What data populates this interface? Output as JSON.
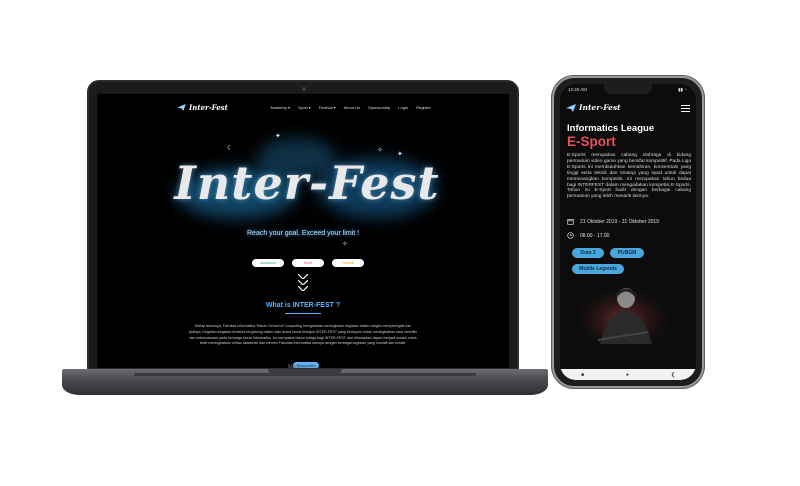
{
  "laptop": {
    "device_label": "MacBook Pro",
    "site": {
      "logo_text": "Inter-Fest",
      "nav": [
        "Academy ▾",
        "Sport ▾",
        "Festival ▾",
        "About Us",
        "Sponsorship",
        "Login",
        "Register"
      ],
      "hero_title": "Inter-Fest",
      "hero_tagline": "Reach your goal, Exceed your limit !",
      "pills": [
        {
          "label": "Academic",
          "color": "#2a9d8f"
        },
        {
          "label": "Sport",
          "color": "#e05a5a"
        },
        {
          "label": "Festival",
          "color": "#d9a21b"
        }
      ],
      "what_title": "What is INTER-FEST ?",
      "description": "Setiap tahunnya, Fakultas Informatika Telkom School of Computing mengadakan serangkaian kegiatan dalam rangka memperingati hari jadinya. Kegiatan-kegiatan tersebut tergabung dalam satu acara besar bertajuk INTER-FEST yang bertujuan untuk meningkatkan rasa memiliki dan kebersamaan pada keluarga besar Informatika. Ini merupakan tahun ketiga bagi INTER-FEST dan diharapkan dapat menjadi wadah untuk lebih meningkatkan civitas akademik dan elemen Fakultas Informatika lainnya dengan berbagai kegiatan yang inovatif dan kreatif.",
      "read_more": "Read more"
    }
  },
  "phone": {
    "status_time": "12:40 AM",
    "status_icons": "▮▮ ◔",
    "logo_text": "Inter-Fest",
    "league": "Informatics League",
    "title": "E-Sport",
    "description": "E-Sports merupakan cabang olahraga di bidang permainan video game yang bersifat kompetitif. Pada Liga E-Sports ini membutuhkan kemahiran, konsentrasi yang tinggi serta teknik dan strategi yang tepat untuk dapat memenangkan kompetisi. Ini merupakan tahun kedua bagi INTERFEST dalam mengadakan kompetisi E-Sports. Tahun ini E-Sport hadir dengan berbagai cabang permainan yang lebih menarik lainnya.",
    "date": "21 Oktober 2019 - 31 Oktober 2019",
    "time": "08.00 - 17.00",
    "games": [
      "Dota 2",
      "PUBGM",
      "Mobile Legends"
    ],
    "nav_buttons": [
      "■",
      "●",
      "❮"
    ],
    "accent": "#e8505b",
    "chip_color": "#4aa7dd"
  }
}
